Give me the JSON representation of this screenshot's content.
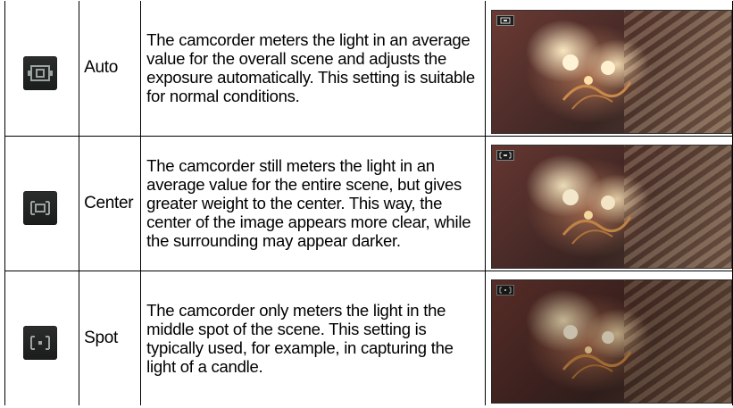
{
  "rows": [
    {
      "icon": "metering-auto-icon",
      "mode": "Auto",
      "description": "The camcorder meters the light in an average value for the overall scene and adjusts the exposure automatically. This setting is suitable for normal conditions."
    },
    {
      "icon": "metering-center-icon",
      "mode": "Center",
      "description": "The camcorder still meters the light in an average value for the entire scene, but gives greater weight to the center. This way, the center of the image appears more clear, while the surrounding may appear darker."
    },
    {
      "icon": "metering-spot-icon",
      "mode": "Spot",
      "description": "The camcorder only meters the light in the middle spot of the scene. This setting is typically used, for example, in capturing the light of a candle."
    }
  ]
}
